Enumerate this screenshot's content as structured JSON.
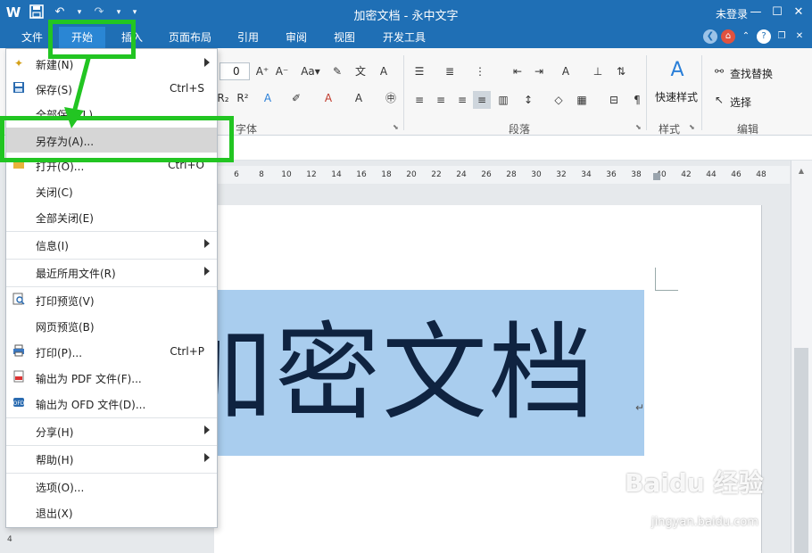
{
  "app": {
    "title": "加密文档 - 永中文字",
    "login": "未登录"
  },
  "menubar": {
    "tabs": [
      "文件",
      "开始",
      "插入",
      "页面布局",
      "引用",
      "审阅",
      "视图",
      "开发工具"
    ]
  },
  "ribbon": {
    "font_size_value": "0",
    "group_font": "字体",
    "group_paragraph": "段落",
    "group_style": "样式",
    "group_edit": "编辑",
    "quick_style": "快速样式",
    "find_replace": "查找替换",
    "select": "选择"
  },
  "ruler": {
    "ticks": [
      "6",
      "8",
      "10",
      "12",
      "14",
      "16",
      "18",
      "20",
      "22",
      "24",
      "26",
      "28",
      "30",
      "32",
      "34",
      "36",
      "38",
      "40",
      "42",
      "44",
      "46",
      "48"
    ]
  },
  "document": {
    "content": "加密文档"
  },
  "file_menu": {
    "items": [
      {
        "label": "新建(N)",
        "submenu": true,
        "icon": "new-doc-icon"
      },
      {
        "label": "保存(S)",
        "shortcut": "Ctrl+S",
        "icon": "save-icon"
      },
      {
        "label": "全部保存(L)"
      },
      {
        "label": "另存为(A)...",
        "highlighted": true
      },
      {
        "label": "打开(O)...",
        "shortcut": "Ctrl+O",
        "icon": "open-folder-icon"
      },
      {
        "label": "关闭(C)"
      },
      {
        "label": "全部关闭(E)"
      },
      {
        "label": "信息(I)",
        "submenu": true
      },
      {
        "label": "最近所用文件(R)",
        "submenu": true
      },
      {
        "label": "打印预览(V)",
        "icon": "print-preview-icon"
      },
      {
        "label": "网页预览(B)"
      },
      {
        "label": "打印(P)...",
        "shortcut": "Ctrl+P",
        "icon": "printer-icon"
      },
      {
        "label": "输出为 PDF 文件(F)...",
        "icon": "pdf-icon"
      },
      {
        "label": "输出为 OFD 文件(D)...",
        "icon": "ofd-icon"
      },
      {
        "label": "分享(H)",
        "submenu": true
      },
      {
        "label": "帮助(H)",
        "submenu": true
      },
      {
        "label": "选项(O)..."
      },
      {
        "label": "退出(X)"
      }
    ]
  },
  "watermark": {
    "brand": "Baidu 经验",
    "url": "jingyan.baidu.com"
  },
  "colors": {
    "titlebar": "#1f6fb5",
    "annotation": "#22c522",
    "selection": "#a9cdee"
  }
}
